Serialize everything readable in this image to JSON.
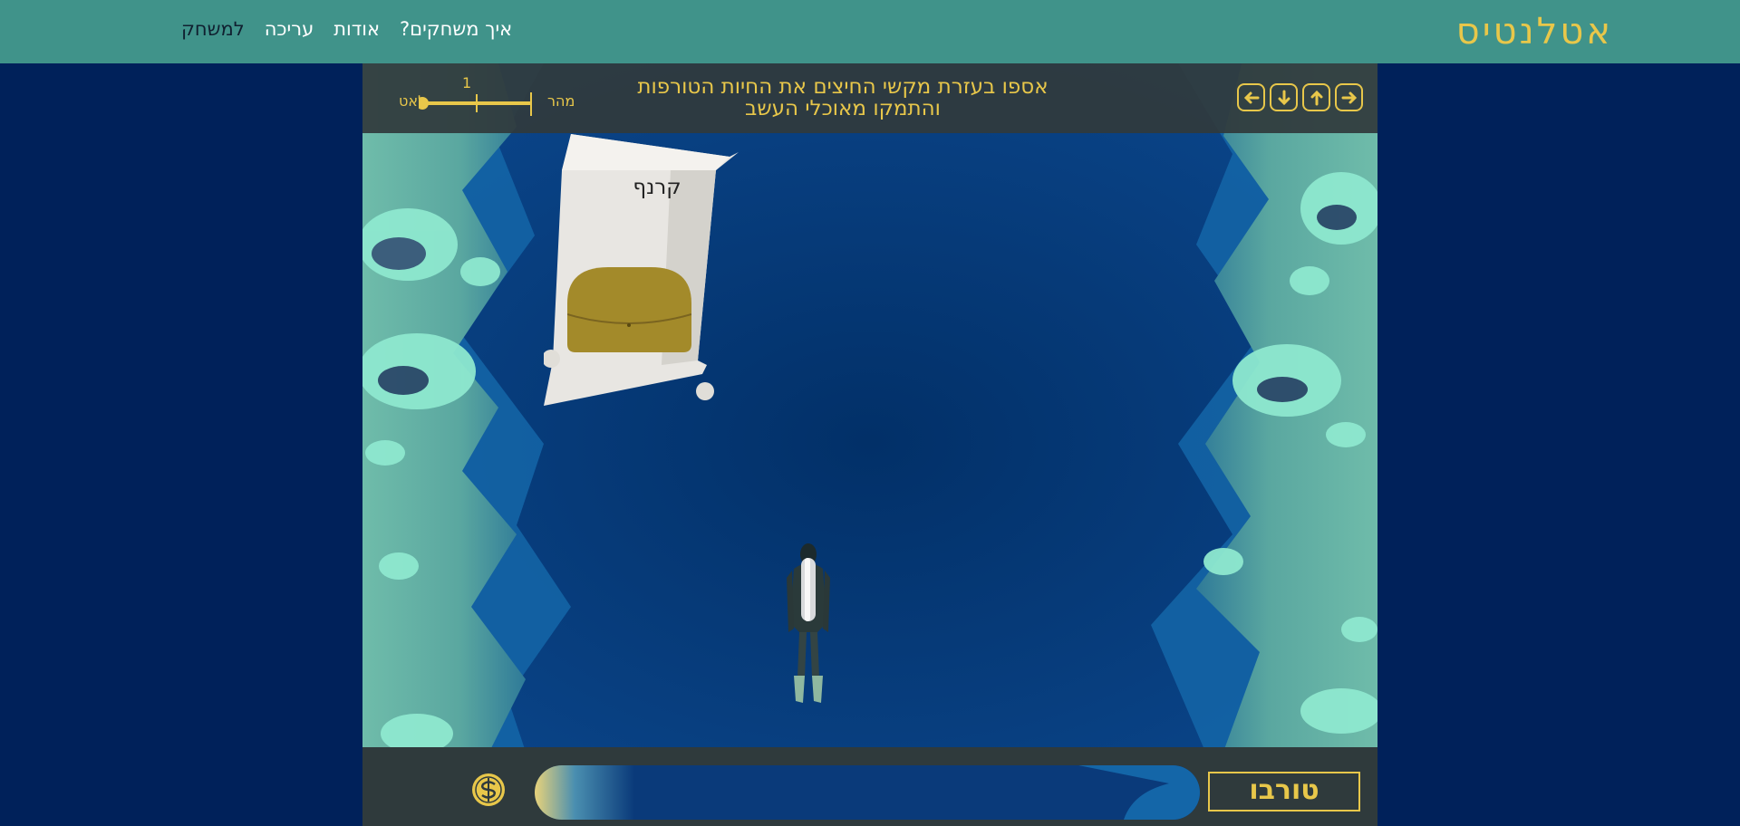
{
  "app": {
    "logo": "אטלנטיס"
  },
  "nav": {
    "items": [
      {
        "label": "למשחק",
        "active": true
      },
      {
        "label": "עריכה",
        "active": false
      },
      {
        "label": "אודות",
        "active": false
      },
      {
        "label": "איך משחקים?",
        "active": false
      }
    ]
  },
  "game": {
    "instruction": "אספו בעזרת מקשי החיצים את החיות הטורפות והתמקו מאוכלי העשב",
    "speed": {
      "fast_label": "מהר",
      "slow_label": "לאט",
      "value": 1,
      "value_label": "1"
    },
    "controls": {
      "icons": [
        "arrow-right-icon",
        "arrow-up-icon",
        "arrow-down-icon",
        "arrow-left-icon"
      ]
    },
    "falling_word": "קרנף",
    "answer": {
      "value": "",
      "placeholder": ""
    },
    "current_word": "טורבו",
    "colors": {
      "accent": "#e8c74a",
      "page_bg": "#00215a",
      "topbar": "#40938a",
      "panel": "#2f3a3c",
      "water": "#0a3a7a"
    }
  }
}
